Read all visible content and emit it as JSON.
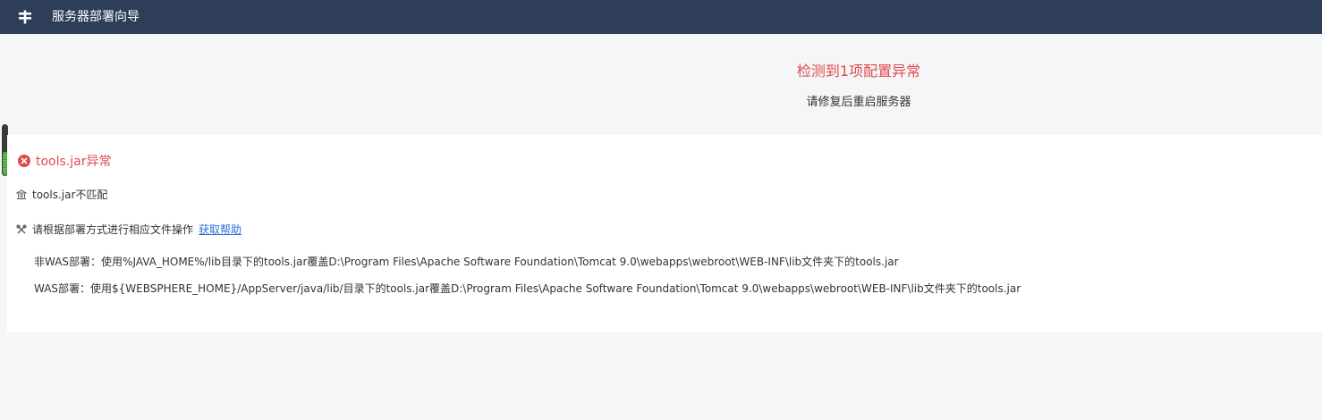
{
  "header": {
    "logo_icon": "stack-logo-icon",
    "title": "服务器部署向导"
  },
  "summary": {
    "headline": "检测到1项配置异常",
    "subtitle": "请修复后重启服务器"
  },
  "issue": {
    "status_icon": "error-circle-icon",
    "title": "tools.jar异常",
    "detail_icon": "bank-icon",
    "detail": "tools.jar不匹配",
    "action_icon": "tools-icon",
    "action": "请根据部署方式进行相应文件操作",
    "help_link": "获取帮助",
    "instructions": [
      "非WAS部署：使用%JAVA_HOME%/lib目录下的tools.jar覆盖D:\\Program Files\\Apache Software Foundation\\Tomcat 9.0\\webapps\\webroot\\WEB-INF\\lib文件夹下的tools.jar",
      "WAS部署：使用${WEBSPHERE_HOME}/AppServer/java/lib/目录下的tools.jar覆盖D:\\Program Files\\Apache Software Foundation\\Tomcat 9.0\\webapps\\webroot\\WEB-INF\\lib文件夹下的tools.jar"
    ]
  },
  "colors": {
    "header_bg": "#2e3e58",
    "error": "#e04b4b",
    "link": "#2b6fd6",
    "page_bg": "#f5f6f8"
  }
}
